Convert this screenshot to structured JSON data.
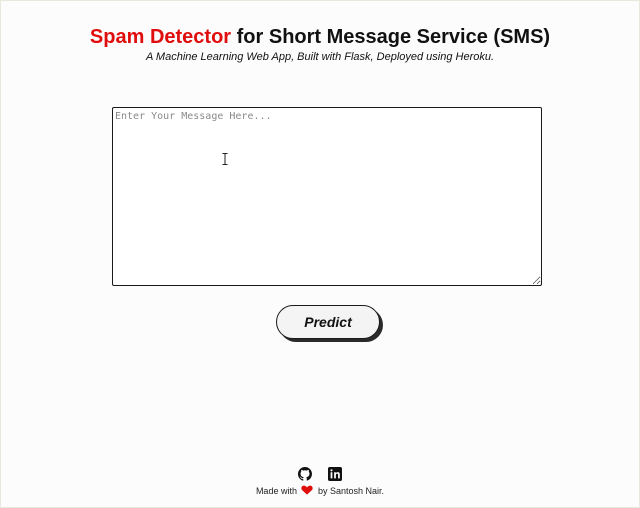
{
  "header": {
    "title_accent": "Spam Detector",
    "title_rest": " for Short Message Service (SMS)",
    "subtitle": "A Machine Learning Web App, Built with Flask, Deployed using Heroku."
  },
  "form": {
    "message_placeholder": "Enter Your Message Here...",
    "message_value": "",
    "predict_label": "Predict"
  },
  "footer": {
    "icons": [
      "github-icon",
      "linkedin-icon"
    ],
    "made_with": "Made with",
    "heart_icon": "heart-icon",
    "by_text": "by Santosh Nair."
  },
  "colors": {
    "accent": "#e00d0d",
    "heart": "#e00d0d"
  }
}
